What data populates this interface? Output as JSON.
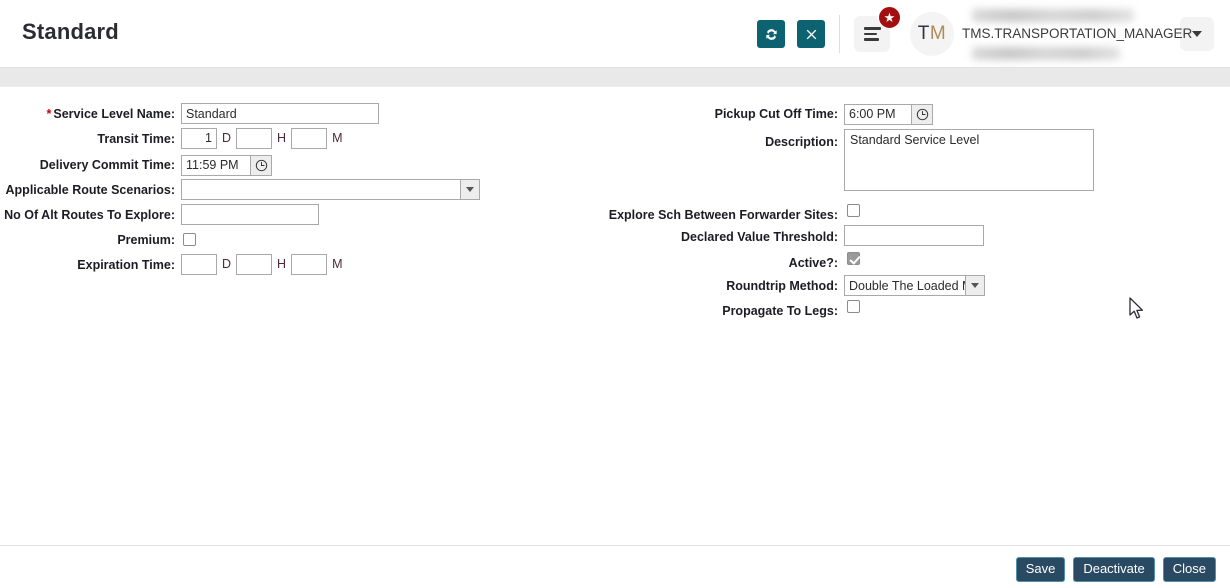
{
  "header": {
    "title": "Standard",
    "refresh_button": "refresh",
    "close_button": "close",
    "menu_button": "menu",
    "badge": "★",
    "avatar_initials_first": "T",
    "avatar_initials_second": "M",
    "user_name": "TMS.TRANSPORTATION_MANAGER",
    "dropdown_button": "expand",
    "accent_teal": "#0d6271",
    "badge_red": "#a10f0f"
  },
  "form": {
    "left": {
      "service_level_name": {
        "label": "Service Level Name:",
        "required": "*",
        "value": "Standard"
      },
      "transit_time": {
        "label": "Transit Time:",
        "days": "1",
        "hours": "",
        "minutes": "",
        "unit_d": "D",
        "unit_h": "H",
        "unit_m": "M"
      },
      "delivery_commit_time": {
        "label": "Delivery Commit Time:",
        "value": "11:59 PM",
        "icon": "clock-icon"
      },
      "applicable_route_scenarios": {
        "label": "Applicable Route Scenarios:",
        "value": ""
      },
      "no_of_alt_routes": {
        "label": "No Of Alt Routes To Explore:",
        "value": ""
      },
      "premium": {
        "label": "Premium:",
        "checked": false
      },
      "expiration_time": {
        "label": "Expiration Time:",
        "days": "",
        "hours": "",
        "minutes": "",
        "unit_d": "D",
        "unit_h": "H",
        "unit_m": "M"
      }
    },
    "right": {
      "pickup_cut_off_time": {
        "label": "Pickup Cut Off Time:",
        "value": "6:00 PM",
        "icon": "clock-icon"
      },
      "description": {
        "label": "Description:",
        "value": "Standard Service Level"
      },
      "explore_sch_between_forwarder_sites": {
        "label": "Explore Sch Between Forwarder Sites:",
        "checked": false
      },
      "declared_value_threshold": {
        "label": "Declared Value Threshold:",
        "value": ""
      },
      "active": {
        "label": "Active?:",
        "checked": true
      },
      "roundtrip_method": {
        "label": "Roundtrip Method:",
        "value": "Double The Loaded M"
      },
      "propagate_to_legs": {
        "label": "Propagate To Legs:",
        "checked": false
      }
    }
  },
  "footer": {
    "save_label": "Save",
    "deactivate_label": "Deactivate",
    "close_label": "Close"
  }
}
